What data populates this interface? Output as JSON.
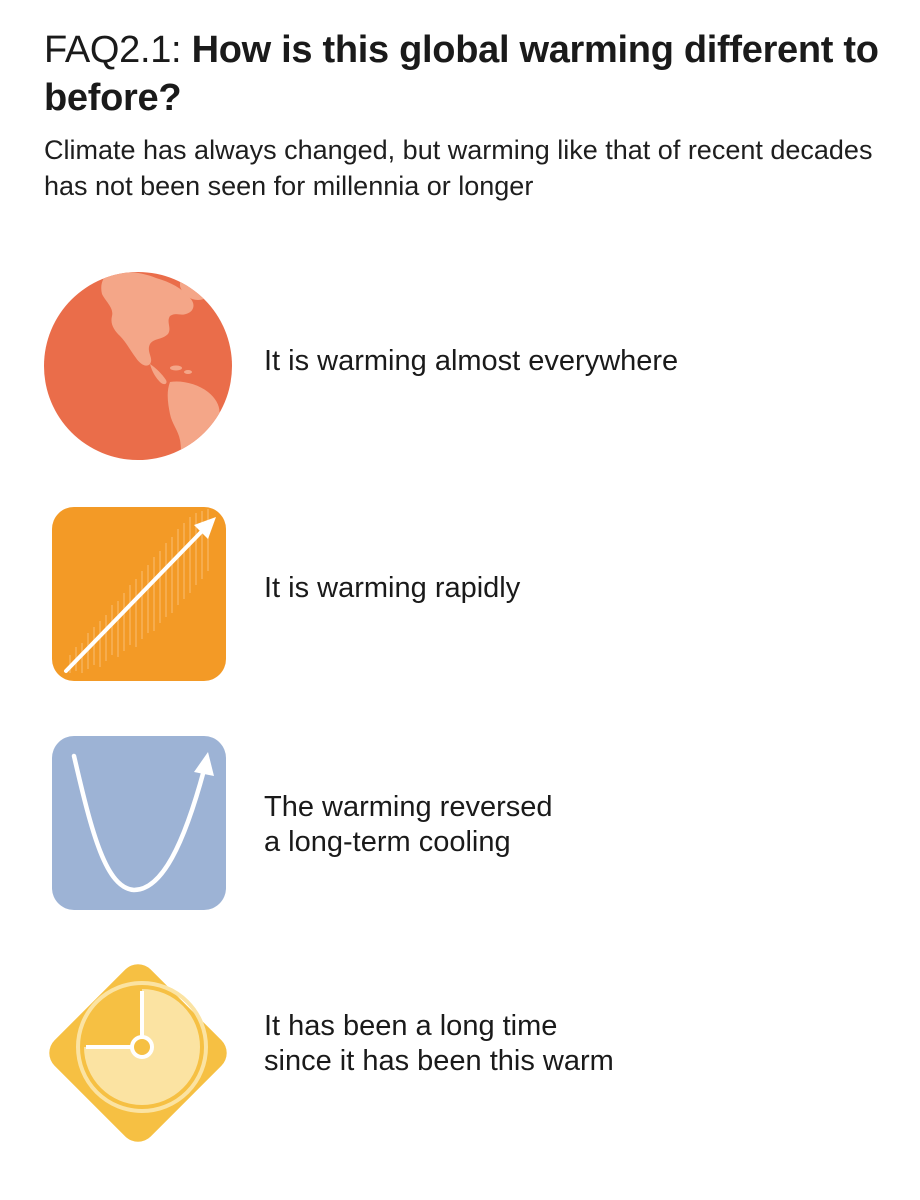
{
  "header": {
    "faq_number": "FAQ2.1:",
    "title": "How is this global warming different to before?",
    "subtitle": "Climate has always changed, but warming like that of recent decades has not been seen for millennia or longer"
  },
  "items": [
    {
      "icon": "globe-icon",
      "color": "#ea6d4a",
      "lines": [
        "It is warming almost everywhere"
      ]
    },
    {
      "icon": "rising-arrow-icon",
      "color": "#f39a26",
      "lines": [
        "It is warming rapidly"
      ]
    },
    {
      "icon": "u-curve-arrow-icon",
      "color": "#9db3d5",
      "lines": [
        "The warming reversed",
        "a long-term cooling"
      ]
    },
    {
      "icon": "clock-icon",
      "color": "#f6c043",
      "lines": [
        "It has been a long time",
        "since it has been this warm"
      ]
    }
  ]
}
